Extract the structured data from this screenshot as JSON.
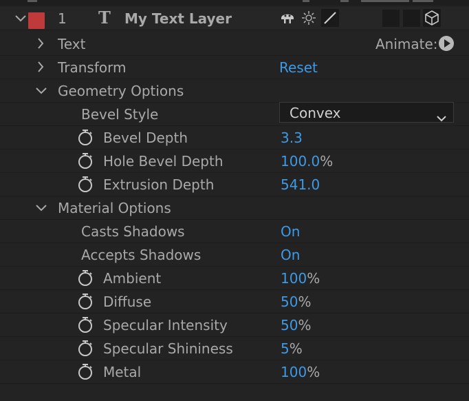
{
  "layer": {
    "number": "1",
    "type_icon": "T",
    "name": "My Text Layer",
    "label_color": "#c0393b"
  },
  "rows": {
    "text": {
      "label": "Text",
      "animate_label": "Animate:"
    },
    "transform": {
      "label": "Transform",
      "reset_label": "Reset"
    },
    "geometry": {
      "label": "Geometry Options"
    },
    "bevel_style": {
      "label": "Bevel Style",
      "value": "Convex"
    },
    "bevel_depth": {
      "label": "Bevel Depth",
      "value": "3.3",
      "unit": ""
    },
    "hole_bevel_depth": {
      "label": "Hole Bevel Depth",
      "value": "100.0",
      "unit": "%"
    },
    "extrusion_depth": {
      "label": "Extrusion Depth",
      "value": "541.0",
      "unit": ""
    },
    "material": {
      "label": "Material Options"
    },
    "casts_shadows": {
      "label": "Casts Shadows",
      "value": "On"
    },
    "accepts_shadows": {
      "label": "Accepts Shadows",
      "value": "On"
    },
    "ambient": {
      "label": "Ambient",
      "value": "100",
      "unit": "%"
    },
    "diffuse": {
      "label": "Diffuse",
      "value": "50",
      "unit": "%"
    },
    "specular_intensity": {
      "label": "Specular Intensity",
      "value": "50",
      "unit": "%"
    },
    "specular_shininess": {
      "label": "Specular Shininess",
      "value": "5",
      "unit": "%"
    },
    "metal": {
      "label": "Metal",
      "value": "100",
      "unit": "%"
    }
  },
  "colors": {
    "background": "#232323",
    "label_text": "#a9a9a9",
    "value_text": "#3d9ae6",
    "layer_label": "#c0393b"
  },
  "icons": {
    "layer_twirl": "chevron-down-icon",
    "group_collapsed": "chevron-right-icon",
    "group_expanded": "chevron-down-icon",
    "stopwatch": "stopwatch-icon",
    "shy": "shy-icon",
    "collapse_transform": "sun-icon",
    "quality": "slash-icon",
    "3d_layer": "cube-icon",
    "animate": "play-circle-icon"
  }
}
